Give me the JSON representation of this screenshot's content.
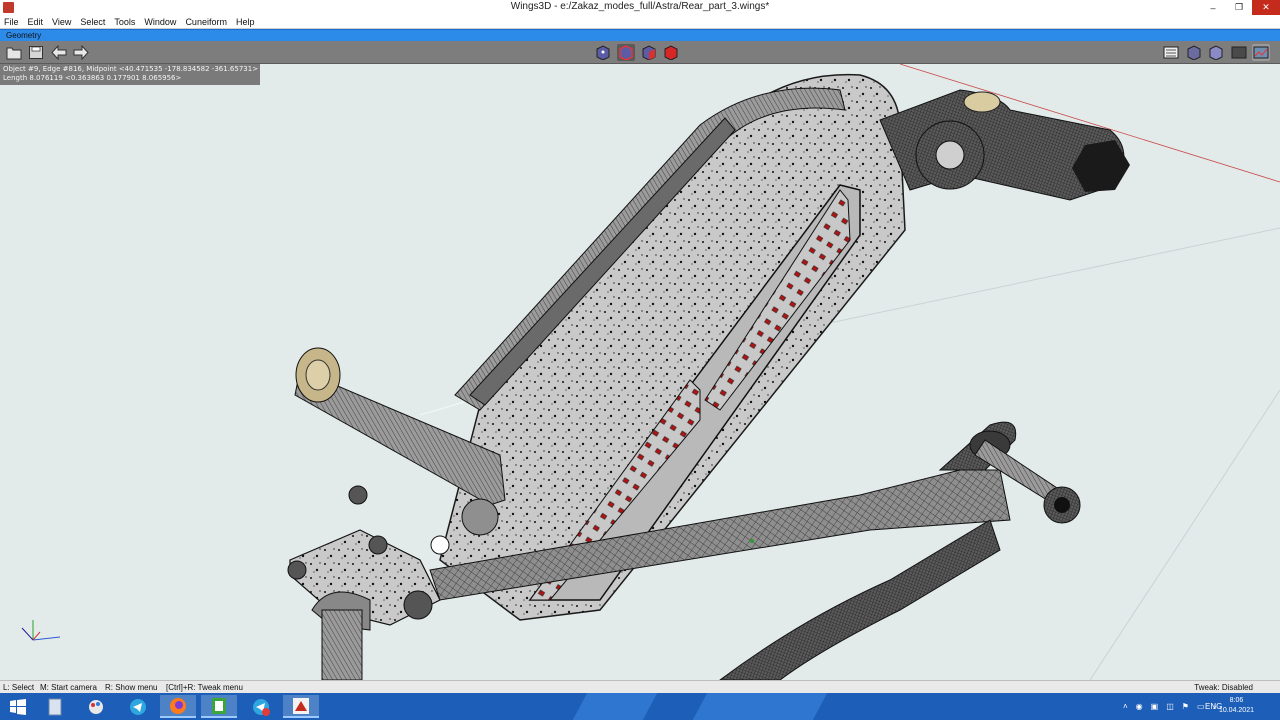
{
  "window": {
    "title": "Wings3D - e:/Zakaz_modes_full/Astra/Rear_part_3.wings*",
    "minimize": "‒",
    "maximize": "❐",
    "close": "✕"
  },
  "menu": [
    "File",
    "Edit",
    "View",
    "Select",
    "Tools",
    "Window",
    "Cuneiform",
    "Help"
  ],
  "geometry_tab": "Geometry",
  "info": {
    "line1": "Object #9, Edge #816, Midpoint <40.471535  -178.834582  -361.65731>",
    "line2": "Length 8.076119  <0.363863  0.177901  8.065956>"
  },
  "toolbar": {
    "left_icons": [
      "open-icon",
      "save-icon",
      "undo-icon",
      "redo-icon"
    ],
    "mode_icons": [
      "vertex-mode-icon",
      "edge-mode-icon",
      "face-mode-icon",
      "body-mode-icon"
    ],
    "right_icons": [
      "wireframe-icon",
      "smooth-shade-icon",
      "flat-shade-icon",
      "ortho-icon",
      "groundplane-icon"
    ]
  },
  "status": {
    "left_click": "L: Select",
    "middle_click": "M: Start camera",
    "right_click": "R: Show menu",
    "ctrl_right": "[Ctrl]+R: Tweak menu",
    "tweak": "Tweak: Disabled"
  },
  "taskbar": {
    "apps": [
      "windows-start-icon",
      "file-explorer-icon",
      "paint-icon",
      "telegram-icon",
      "firefox-icon",
      "notes-icon",
      "telegram-badge-icon",
      "wings3d-icon"
    ],
    "lang": "ENG",
    "time": "8:06",
    "date": "10.04.2021"
  },
  "colors": {
    "accent": "#2c8ae8",
    "toolbar": "#7d7d7d",
    "viewport": "#e2ebea",
    "close": "#c42b1c",
    "taskbar": "#1d5fb8"
  }
}
